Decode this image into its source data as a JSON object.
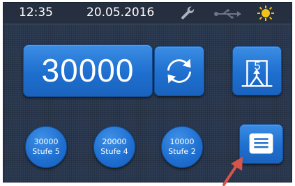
{
  "status": {
    "time": "12:35",
    "date": "20.05.2016",
    "icons": [
      "wrench-icon",
      "usb-icon",
      "sun-icon"
    ],
    "sun_color": "#f2c21a"
  },
  "counter": {
    "value": "30000"
  },
  "level_button": {
    "level": "5"
  },
  "presets": [
    {
      "value": "30000",
      "label": "Stufe 5"
    },
    {
      "value": "20000",
      "label": "Stufe 4"
    },
    {
      "value": "10000",
      "label": "Stufe 2"
    }
  ],
  "colors": {
    "button_blue": "#1e6fcf",
    "screen_bg": "#2e3d55",
    "annotation_arrow": "#d9534a"
  }
}
